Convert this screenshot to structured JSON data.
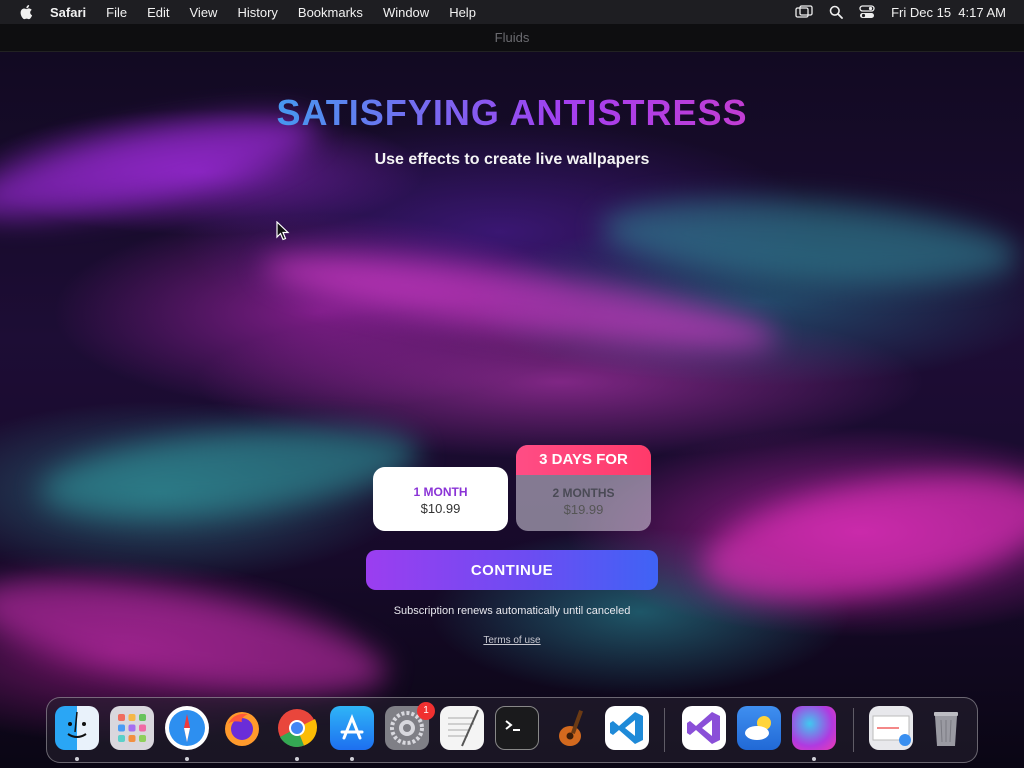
{
  "menubar": {
    "items": [
      "Safari",
      "File",
      "Edit",
      "View",
      "History",
      "Bookmarks",
      "Window",
      "Help"
    ],
    "clock": "Fri Dec 15  4:17 AM"
  },
  "window": {
    "title": "Fluids"
  },
  "hero": {
    "headline": "SATISFYING ANTISTRESS",
    "subheadline": "Use effects to create live wallpapers"
  },
  "plans": [
    {
      "name": "1 MONTH",
      "price": "$10.99",
      "selected": true
    },
    {
      "ribbon": "3 DAYS FOR",
      "name": "2 MONTHS",
      "price": "$19.99",
      "selected": false
    }
  ],
  "continue_label": "CONTINUE",
  "renew_note": "Subscription renews automatically until canceled",
  "terms_label": "Terms of use",
  "dock": {
    "apps": [
      "finder",
      "launchpad",
      "safari",
      "firefox",
      "chrome",
      "app-store",
      "system-settings",
      "textedit",
      "terminal",
      "garageband",
      "vscode",
      "visual-studio",
      "weather",
      "fluids",
      "preview",
      "trash"
    ],
    "settings_badge": "1"
  }
}
